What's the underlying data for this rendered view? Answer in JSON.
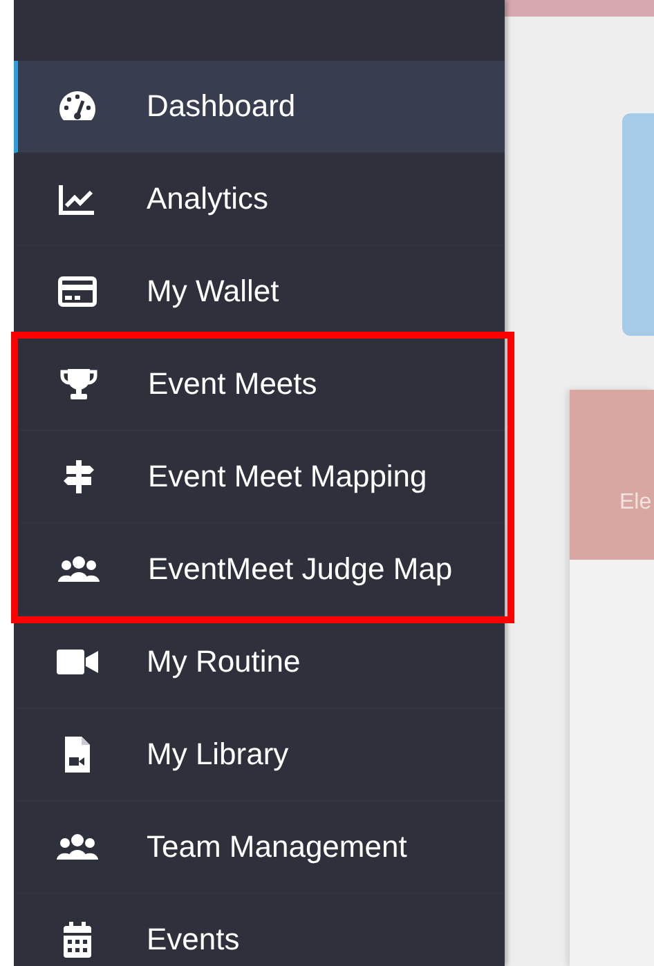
{
  "sidebar": {
    "items": [
      {
        "label": "Dashboard",
        "selected": true,
        "highlighted": false
      },
      {
        "label": "Analytics",
        "selected": false,
        "highlighted": false
      },
      {
        "label": "My Wallet",
        "selected": false,
        "highlighted": false
      },
      {
        "label": "Event Meets",
        "selected": false,
        "highlighted": true
      },
      {
        "label": "Event Meet Mapping",
        "selected": false,
        "highlighted": true
      },
      {
        "label": "EventMeet Judge Map",
        "selected": false,
        "highlighted": true
      },
      {
        "label": "My Routine",
        "selected": false,
        "highlighted": false
      },
      {
        "label": "My Library",
        "selected": false,
        "highlighted": false
      },
      {
        "label": "Team Management",
        "selected": false,
        "highlighted": false
      },
      {
        "label": "Events",
        "selected": false,
        "highlighted": false
      }
    ]
  },
  "content": {
    "card_text": "Ele"
  }
}
